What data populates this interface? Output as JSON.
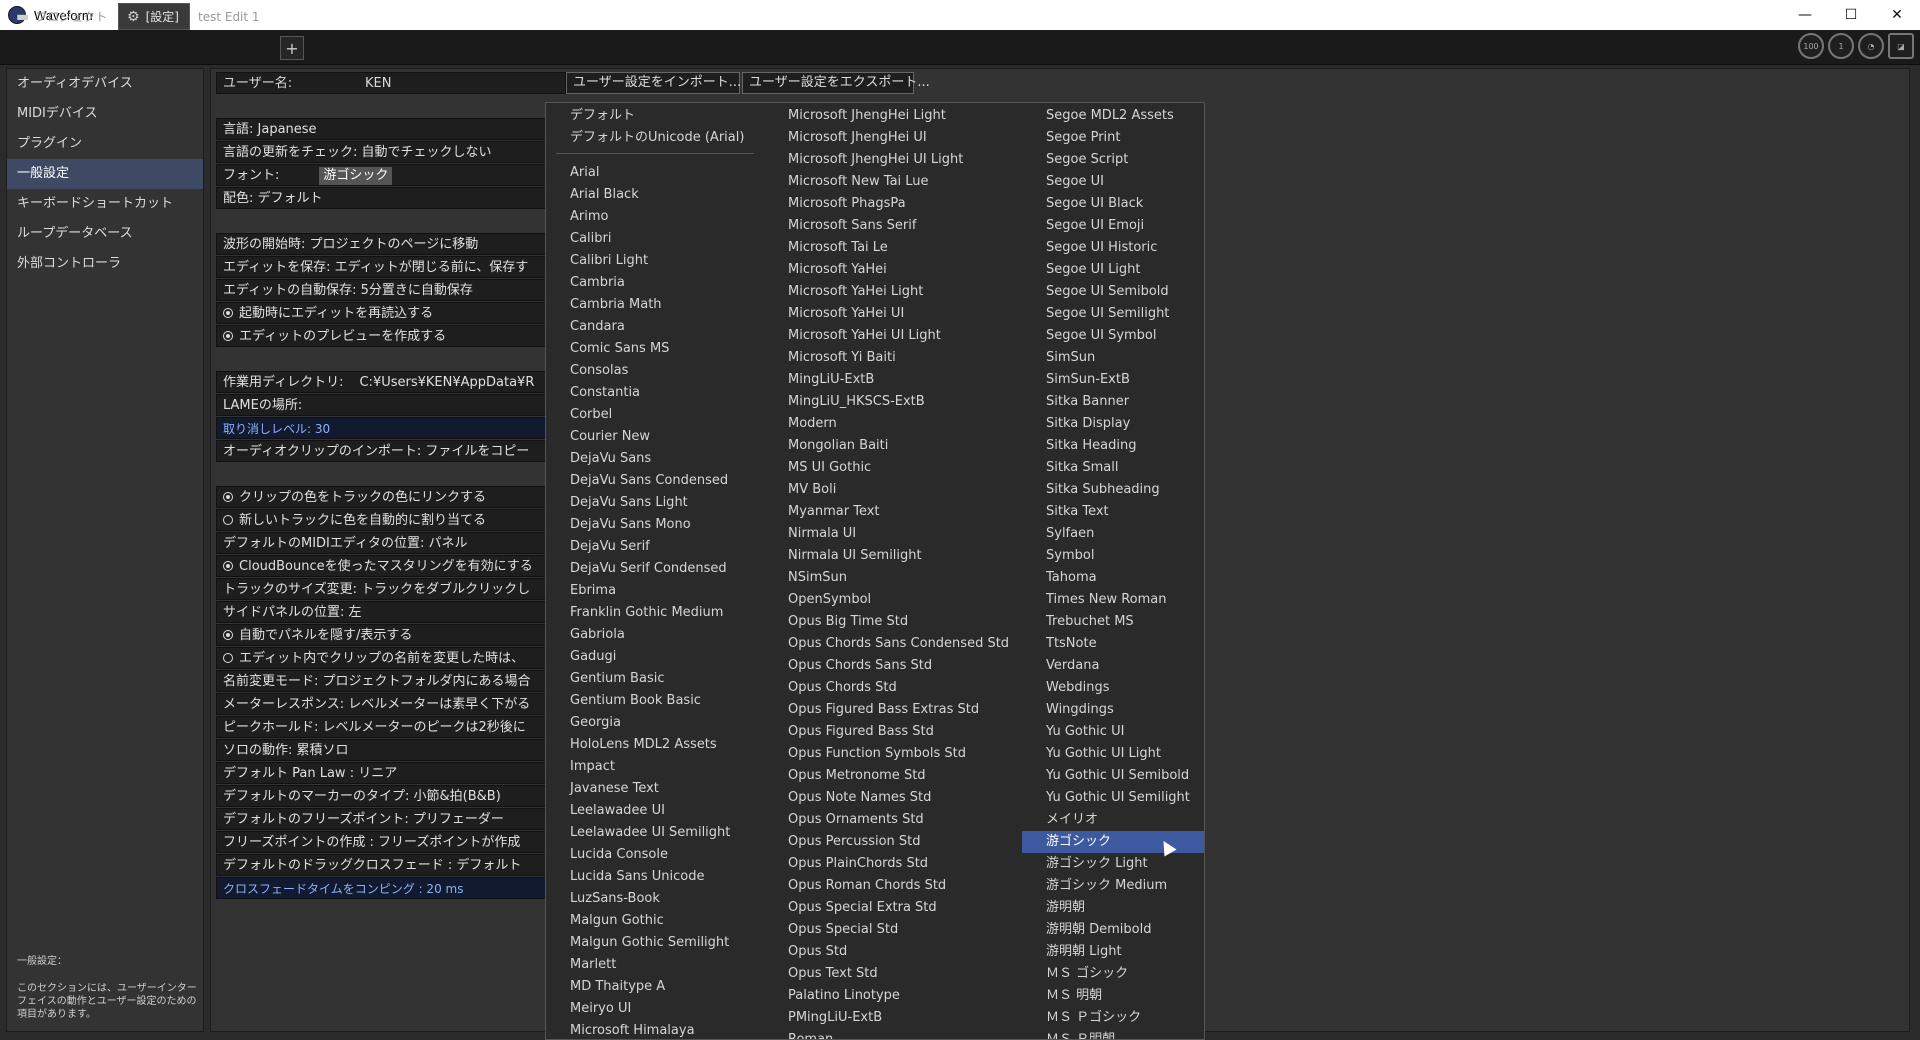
{
  "window": {
    "title": "Waveform",
    "minimize": "—",
    "maximize": "☐",
    "close": "✕"
  },
  "tabs": [
    {
      "label": "プロジェクト",
      "icon": "folder-icon"
    },
    {
      "label": "[設定]",
      "icon": "gear-icon"
    },
    {
      "label": "test Edit 1"
    }
  ],
  "tab_add": "+",
  "meters": [
    "100",
    "1",
    "",
    ""
  ],
  "sidebar": {
    "items": [
      "オーディオデバイス",
      "MIDIデバイス",
      "プラグイン",
      "一般設定",
      "キーボードショートカット",
      "ループデータベース",
      "外部コントローラ"
    ],
    "selected_index": 3,
    "footer_title": "一般設定：",
    "footer_text": "このセクションには、ユーザーインターフェイスの動作とユーザー設定のための項目があります。"
  },
  "user": {
    "label": "ユーザー名:",
    "value": "KEN",
    "import_button": "ユーザー設定をインポート...",
    "export_button": "ユーザー設定をエクスポート..."
  },
  "settings": {
    "group1": [
      {
        "text": "言語: Japanese"
      },
      {
        "text": "言語の更新をチェック: 自動でチェックしない"
      },
      {
        "text": "フォント:",
        "value": "游ゴシック"
      },
      {
        "text": "配色: デフォルト"
      }
    ],
    "group2": [
      {
        "text": "波形の開始時: プロジェクトのページに移動"
      },
      {
        "text": "エディットを保存: エディットが閉じる前に、保存す"
      },
      {
        "text": "エディットの自動保存: 5分置きに自動保存"
      },
      {
        "text": "起動時にエディットを再読込する",
        "radio": true
      },
      {
        "text": "エディットのプレビューを作成する",
        "radio": true
      }
    ],
    "group3": [
      {
        "text": "作業用ディレクトリ:",
        "value": "C:¥Users¥KEN¥AppData¥R"
      },
      {
        "text": "LAMEの場所:"
      },
      {
        "text": "取り消しレベル: 30",
        "accent": true
      },
      {
        "text": "オーディオクリップのインポート: ファイルをコピー"
      }
    ],
    "group4": [
      {
        "text": "クリップの色をトラックの色にリンクする",
        "radio": true
      },
      {
        "text": "新しいトラックに色を自動的に割り当てる",
        "radio": false
      },
      {
        "text": "デフォルトのMIDIエディタの位置: パネル"
      },
      {
        "text": "CloudBounceを使ったマスタリングを有効にする",
        "radio": true
      },
      {
        "text": "トラックのサイズ変更: トラックをダブルクリックし"
      },
      {
        "text": "サイドパネルの位置: 左"
      },
      {
        "text": "自動でパネルを隠す/表示する",
        "radio": true
      },
      {
        "text": "エディット内でクリップの名前を変更した時は、",
        "radio": false
      },
      {
        "text": "名前変更モード: プロジェクトフォルダ内にある場合"
      },
      {
        "text": "メーターレスポンス: レベルメーターは素早く下がる"
      },
      {
        "text": "ピークホールド: レベルメーターのピークは2秒後に"
      },
      {
        "text": "ソロの動作: 累積ソロ"
      },
      {
        "text": "デフォルト Pan Law : リニア"
      },
      {
        "text": "デフォルトのマーカーのタイプ: 小節&拍(B&B)"
      },
      {
        "text": "デフォルトのフリーズポイント: プリフェーダー"
      },
      {
        "text": "フリーズポイントの作成 : フリーズポイントが作成"
      },
      {
        "text": "デフォルトのドラッグクロスフェード : デフォルト"
      },
      {
        "text": "クロスフェードタイムをコンピング : 20 ms",
        "accent": true
      }
    ]
  },
  "font_dropdown": {
    "header": [
      "デフォルト",
      "デフォルトのUnicode (Arial)"
    ],
    "col1": [
      "Arial",
      "Arial Black",
      "Arimo",
      "Calibri",
      "Calibri Light",
      "Cambria",
      "Cambria Math",
      "Candara",
      "Comic Sans MS",
      "Consolas",
      "Constantia",
      "Corbel",
      "Courier New",
      "DejaVu Sans",
      "DejaVu Sans Condensed",
      "DejaVu Sans Light",
      "DejaVu Sans Mono",
      "DejaVu Serif",
      "DejaVu Serif Condensed",
      "Ebrima",
      "Franklin Gothic Medium",
      "Gabriola",
      "Gadugi",
      "Gentium Basic",
      "Gentium Book Basic",
      "Georgia",
      "HoloLens MDL2 Assets",
      "Impact",
      "Javanese Text",
      "Leelawadee UI",
      "Leelawadee UI Semilight",
      "Lucida Console",
      "Lucida Sans Unicode",
      "LuzSans-Book",
      "Malgun Gothic",
      "Malgun Gothic Semilight",
      "Marlett",
      "MD Thaitype A",
      "Meiryo UI",
      "Microsoft Himalaya"
    ],
    "col2": [
      "Microsoft JhengHei Light",
      "Microsoft JhengHei UI",
      "Microsoft JhengHei UI Light",
      "Microsoft New Tai Lue",
      "Microsoft PhagsPa",
      "Microsoft Sans Serif",
      "Microsoft Tai Le",
      "Microsoft YaHei",
      "Microsoft YaHei Light",
      "Microsoft YaHei UI",
      "Microsoft YaHei UI Light",
      "Microsoft Yi Baiti",
      "MingLiU-ExtB",
      "MingLiU_HKSCS-ExtB",
      "Modern",
      "Mongolian Baiti",
      "MS UI Gothic",
      "MV Boli",
      "Myanmar Text",
      "Nirmala UI",
      "Nirmala UI Semilight",
      "NSimSun",
      "OpenSymbol",
      "Opus Big Time Std",
      "Opus Chords Sans Condensed Std",
      "Opus Chords Sans Std",
      "Opus Chords Std",
      "Opus Figured Bass Extras Std",
      "Opus Figured Bass Std",
      "Opus Function Symbols Std",
      "Opus Metronome Std",
      "Opus Note Names Std",
      "Opus Ornaments Std",
      "Opus Percussion Std",
      "Opus PlainChords Std",
      "Opus Roman Chords Std",
      "Opus Special Extra Std",
      "Opus Special Std",
      "Opus Std",
      "Opus Text Std",
      "Palatino Linotype",
      "PMingLiU-ExtB",
      "Roman"
    ],
    "col3": [
      "Segoe MDL2 Assets",
      "Segoe Print",
      "Segoe Script",
      "Segoe UI",
      "Segoe UI Black",
      "Segoe UI Emoji",
      "Segoe UI Historic",
      "Segoe UI Light",
      "Segoe UI Semibold",
      "Segoe UI Semilight",
      "Segoe UI Symbol",
      "SimSun",
      "SimSun-ExtB",
      "Sitka Banner",
      "Sitka Display",
      "Sitka Heading",
      "Sitka Small",
      "Sitka Subheading",
      "Sitka Text",
      "Sylfaen",
      "Symbol",
      "Tahoma",
      "Times New Roman",
      "Trebuchet MS",
      "TtsNote",
      "Verdana",
      "Webdings",
      "Wingdings",
      "Yu Gothic UI",
      "Yu Gothic UI Light",
      "Yu Gothic UI Semibold",
      "Yu Gothic UI Semilight",
      "メイリオ",
      "游ゴシック",
      "游ゴシック Light",
      "游ゴシック Medium",
      "游明朝",
      "游明朝 Demibold",
      "游明朝 Light",
      "ＭＳ ゴシック",
      "ＭＳ 明朝",
      "ＭＳ Ｐゴシック",
      "ＭＳ Ｐ明朝"
    ],
    "selected": "游ゴシック"
  }
}
